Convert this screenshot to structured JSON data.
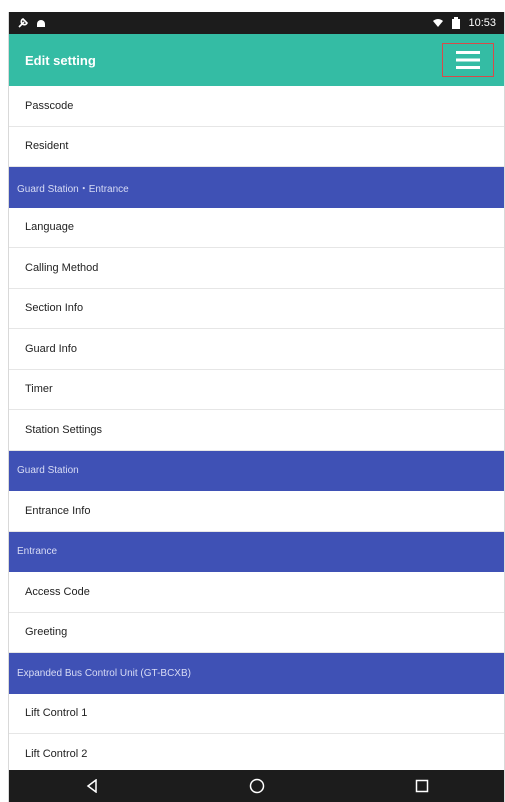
{
  "status_bar": {
    "time": "10:53"
  },
  "app_bar": {
    "title": "Edit setting"
  },
  "list": {
    "items_top": [
      "Passcode",
      "Resident"
    ],
    "section_guard_entrance": "Guard Station・Entrance",
    "guard_entrance_items": [
      "Language",
      "Calling Method",
      "Section Info",
      "Guard Info",
      "Timer",
      "Station Settings"
    ],
    "section_guard": "Guard Station",
    "guard_items": [
      "Entrance Info"
    ],
    "section_entrance": "Entrance",
    "entrance_items": [
      "Access Code",
      "Greeting"
    ],
    "section_expanded": "Expanded Bus Control Unit (GT-BCXB)",
    "expanded_items": [
      "Lift Control 1",
      "Lift Control 2"
    ]
  },
  "colors": {
    "accent": "#34bca4",
    "section_header": "#3f51b5",
    "status_bar": "#1c1c1c"
  }
}
